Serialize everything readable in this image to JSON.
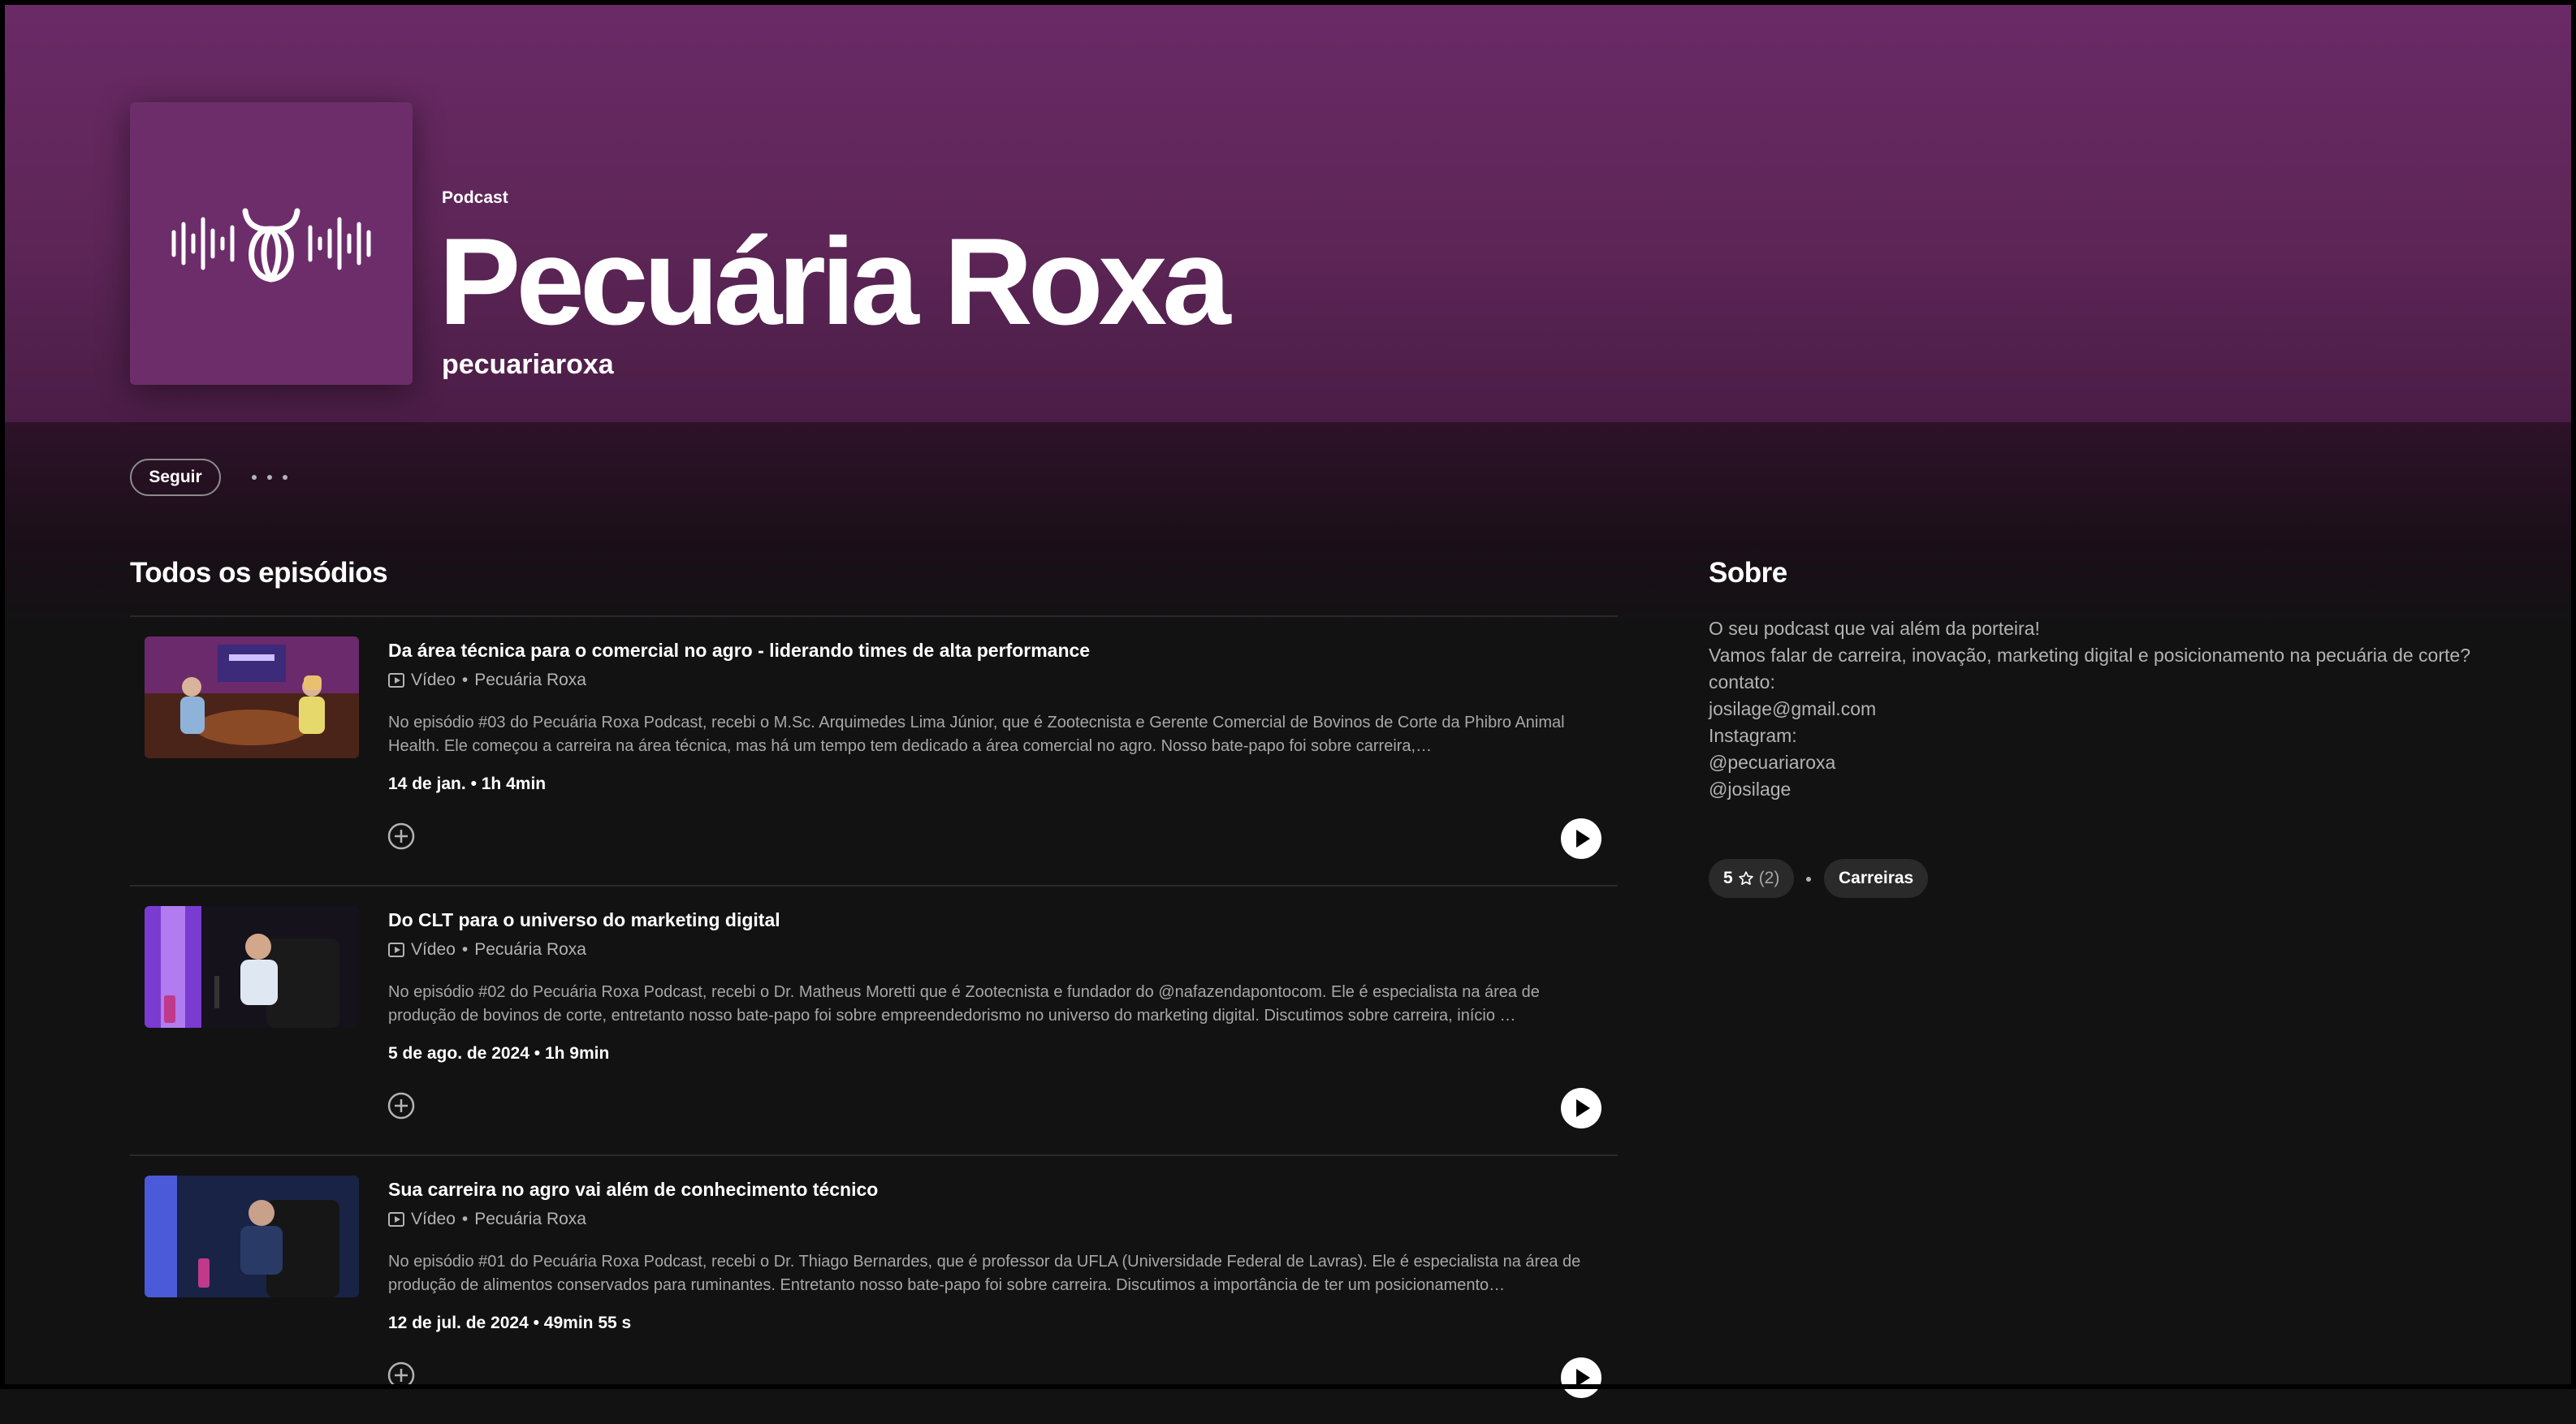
{
  "header": {
    "kind_label": "Podcast",
    "title": "Pecuária Roxa",
    "author": "pecuariaroxa",
    "cover_icon": "waveform-bull-logo",
    "accent_color": "#6a2a66"
  },
  "actions": {
    "follow_label": "Seguir",
    "more_icon": "more-options-icon"
  },
  "episodes_section": {
    "title": "Todos os episódios",
    "items": [
      {
        "title": "Da área técnica para o comercial no agro - liderando times de alta performance",
        "type_label": "Vídeo",
        "show": "Pecuária Roxa",
        "description": "No episódio #03 do Pecuária Roxa Podcast, recebi o M.Sc. Arquimedes Lima Júnior, que é Zootecnista e Gerente Comercial de Bovinos de Corte da Phibro Animal Health. Ele começou a carreira na área técnica, mas há um tempo tem dedicado a área comercial no agro. Nosso bate-papo foi sobre carreira,…",
        "date": "14 de jan.",
        "duration": "1h 4min"
      },
      {
        "title": "Do CLT para o universo do marketing digital",
        "type_label": "Vídeo",
        "show": "Pecuária Roxa",
        "description": "No episódio #02 do Pecuária Roxa Podcast, recebi o Dr. Matheus Moretti que é Zootecnista e fundador do @nafazendapontocom. Ele é especialista na área de produção de bovinos de corte, entretanto nosso bate-papo foi sobre empreendedorismo no universo do marketing digital. Discutimos sobre carreira, início …",
        "date": "5 de ago. de 2024",
        "duration": "1h 9min"
      },
      {
        "title": "Sua carreira no agro vai além de conhecimento técnico",
        "type_label": "Vídeo",
        "show": "Pecuária Roxa",
        "description": "No episódio #01 do Pecuária Roxa Podcast, recebi o Dr. Thiago Bernardes, que é professor da UFLA (Universidade Federal de Lavras). Ele é especialista na área de produção de alimentos conservados para ruminantes. Entretanto nosso bate-papo foi sobre carreira. Discutimos a importância de ter um posicionamento…",
        "date": "12 de jul. de 2024",
        "duration": "49min 55 s"
      }
    ]
  },
  "about": {
    "title": "Sobre",
    "lines": [
      "O seu podcast que vai além da porteira!",
      "Vamos falar de carreira, inovação, marketing digital e posicionamento na pecuária de corte?",
      "contato:",
      "josilage@gmail.com",
      "Instagram:",
      "@pecuariaroxa",
      "@josilage"
    ],
    "rating": "5",
    "rating_count": "(2)",
    "category": "Carreiras"
  }
}
